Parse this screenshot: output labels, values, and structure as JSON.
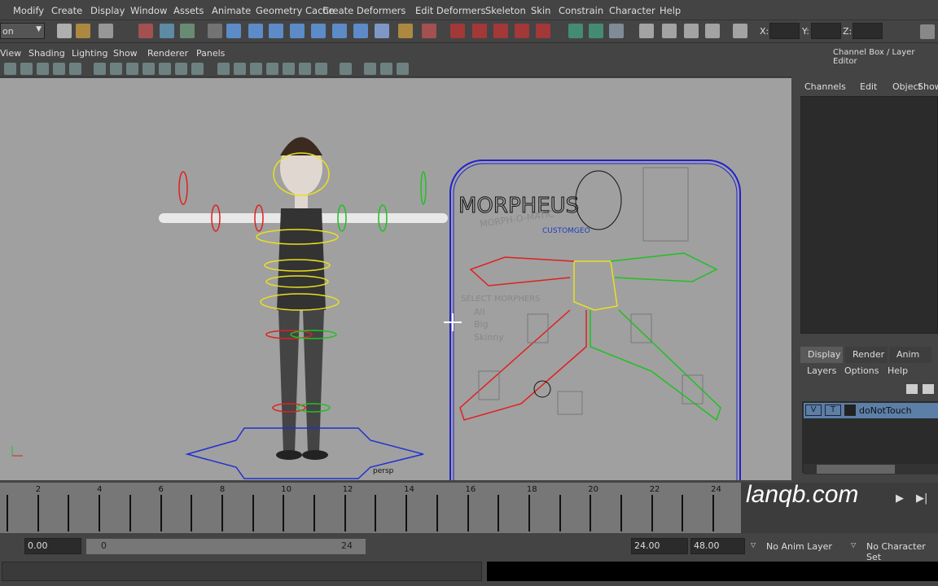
{
  "menubar": {
    "items": [
      "Modify",
      "Create",
      "Display",
      "Window",
      "Assets",
      "Animate",
      "Geometry Cache",
      "Create Deformers",
      "Edit Deformers",
      "Skeleton",
      "Skin",
      "Constrain",
      "Character",
      "Help"
    ]
  },
  "status": {
    "mode_value": "on",
    "x_label": "X:",
    "y_label": "Y:",
    "z_label": "Z:",
    "x_value": "",
    "y_value": "",
    "z_value": ""
  },
  "panel_menu": {
    "items": [
      "View",
      "Shading",
      "Lighting",
      "Show",
      "Renderer",
      "Panels"
    ]
  },
  "viewport": {
    "camera_label": "persp",
    "picker": {
      "title": "MORPHEUS",
      "subtitle": "MORPH-O-MATIC",
      "custom_geo": "CUSTOMGEO",
      "select_label": "SELECT MORPHERS",
      "options": [
        "All",
        "Big",
        "Skinny"
      ]
    },
    "colors": {
      "background": "#a0a0a0",
      "picker_border": "#2020d0",
      "left_side": "#e02020",
      "right_side": "#20c020",
      "center": "#e8e020"
    }
  },
  "channel_box": {
    "title": "Channel Box / Layer Editor",
    "menu": [
      "Channels",
      "Edit",
      "Object",
      "Show"
    ]
  },
  "layer_editor": {
    "tabs": [
      "Display",
      "Render",
      "Anim"
    ],
    "active_tab": "Display",
    "menu": [
      "Layers",
      "Options",
      "Help"
    ],
    "layers": [
      {
        "visible": "V",
        "template": "T",
        "name": "doNotTouch"
      }
    ]
  },
  "timeline": {
    "labels": [
      "2",
      "4",
      "6",
      "8",
      "10",
      "12",
      "14",
      "16",
      "18",
      "20",
      "22",
      "24"
    ],
    "watermark": "lanqb.com"
  },
  "range": {
    "start_time": "0.00",
    "range_start": "0",
    "range_end": "24",
    "end_time": "24.00",
    "max_time": "48.00",
    "anim_layer": "No Anim Layer",
    "character_set": "No Character Set"
  },
  "command_line": {
    "value": ""
  }
}
